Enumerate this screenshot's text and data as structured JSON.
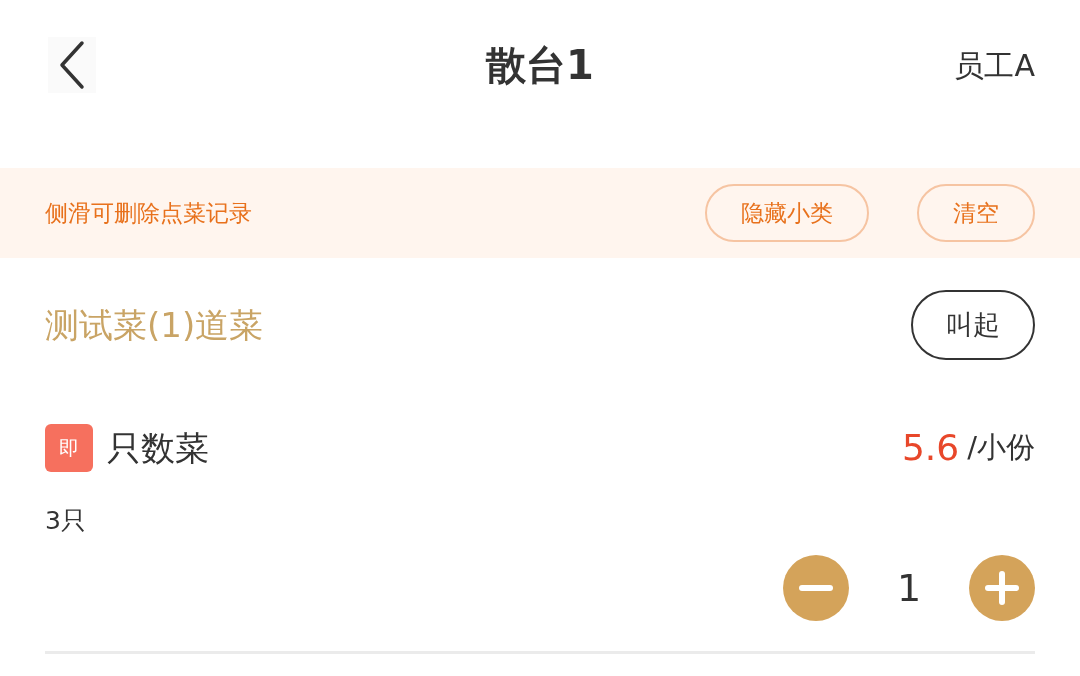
{
  "header": {
    "title": "散台1",
    "user": "员工A"
  },
  "notice": {
    "text": "侧滑可删除点菜记录",
    "buttons": [
      "隐藏小类",
      "清空"
    ]
  },
  "categories": [
    {
      "title": "测试菜(1)道菜",
      "action": "叫起",
      "items": [
        {
          "badge": "即",
          "name": "只数菜",
          "price": "5.6",
          "unit": "/小份",
          "spec": "3只",
          "quantity": "1"
        }
      ]
    }
  ]
}
